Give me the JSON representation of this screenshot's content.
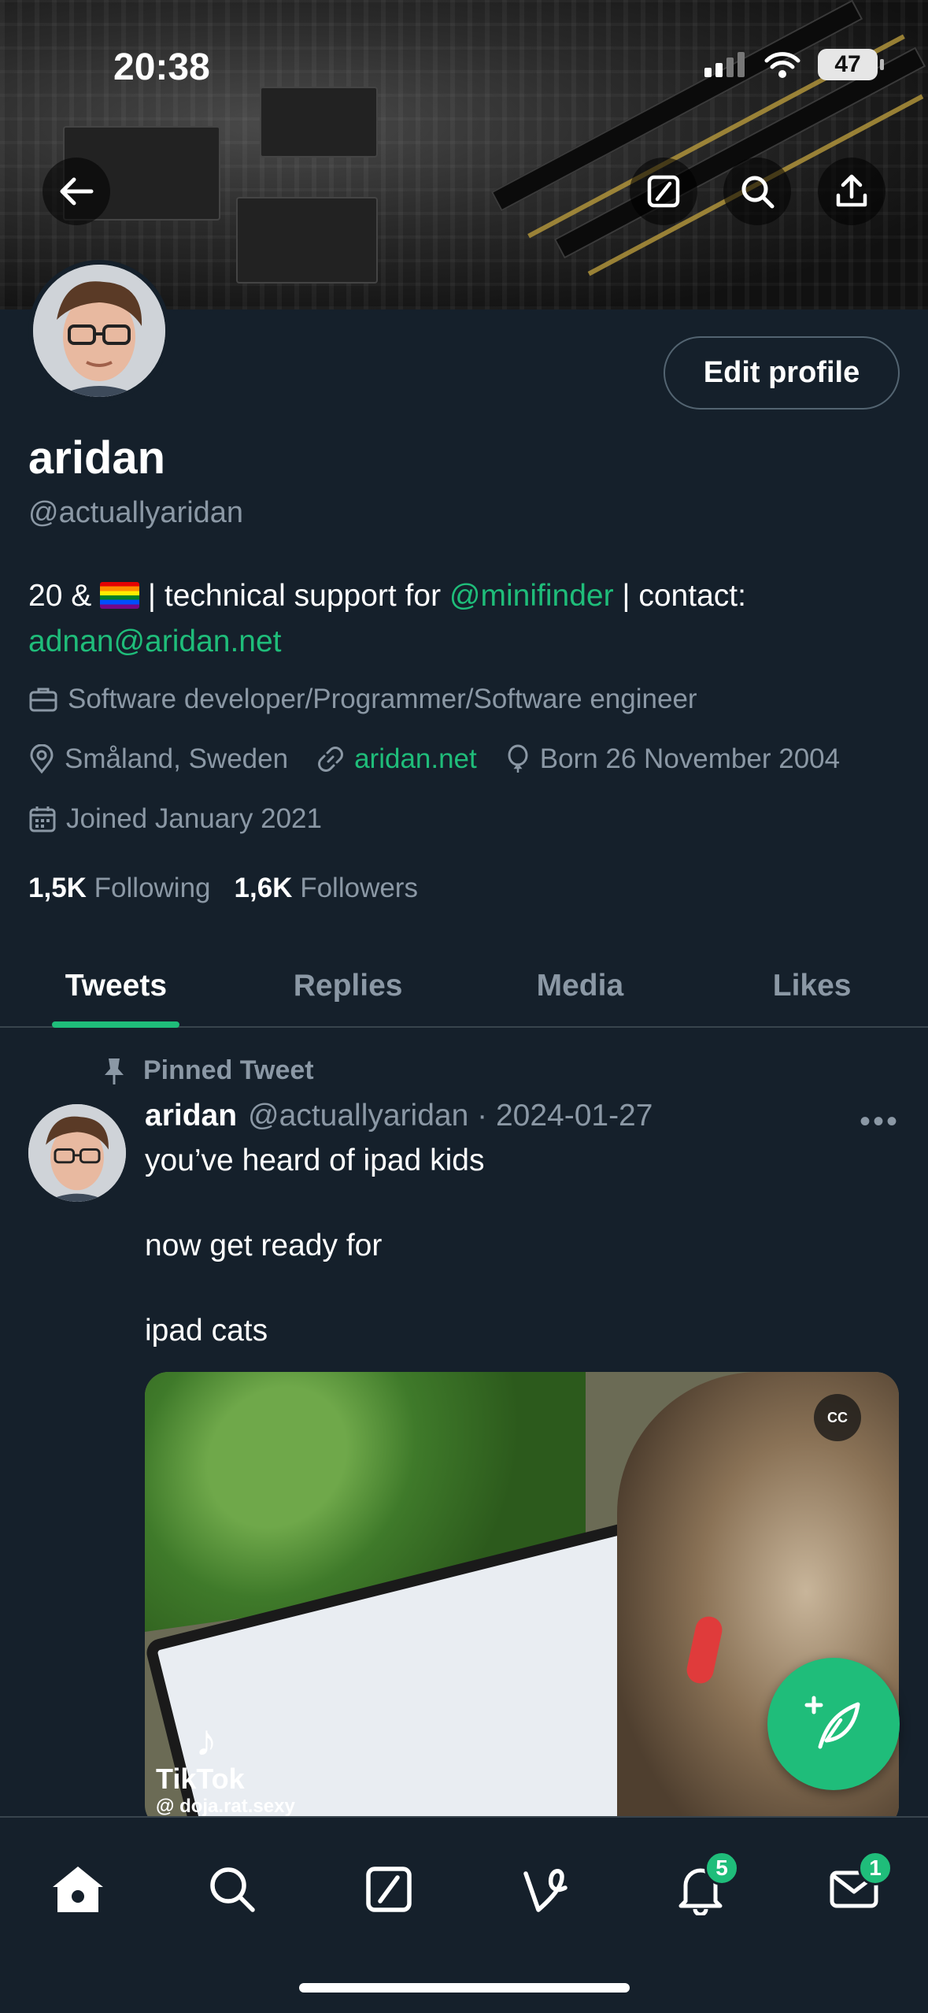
{
  "status_bar": {
    "time": "20:38",
    "battery": "47"
  },
  "profile": {
    "edit_button": "Edit profile",
    "display_name": "aridan",
    "handle": "@actuallyaridan",
    "bio": {
      "prefix": "20 & ",
      "mid": " | technical support for ",
      "mention": "@minifinder",
      "suffix": " | contact:",
      "email": "adnan@aridan.net"
    },
    "profession": "Software developer/Programmer/Software engineer",
    "location": "Småland, Sweden",
    "website": "aridan.net",
    "birthday": "Born 26 November 2004",
    "joined": "Joined January 2021",
    "following_count": "1,5K",
    "following_label": "Following",
    "followers_count": "1,6K",
    "followers_label": "Followers"
  },
  "tabs": [
    {
      "label": "Tweets"
    },
    {
      "label": "Replies"
    },
    {
      "label": "Media"
    },
    {
      "label": "Likes"
    }
  ],
  "pinned_tweet": {
    "pinned_label": "Pinned Tweet",
    "author_name": "aridan",
    "author_handle_date": "@actuallyaridan · 2024-01-27",
    "more": "•••",
    "lines": [
      "you’ve heard of ipad kids",
      "now get ready for",
      "ipad cats"
    ],
    "media": {
      "cc_label": "CC",
      "tiktok_logo": "♪",
      "tiktok_word": "TikTok",
      "tiktok_user": "@ doja.rat.sexy"
    }
  },
  "bottom_nav": {
    "notifications_badge": "5",
    "messages_badge": "1"
  },
  "colors": {
    "background": "#15202b",
    "accent": "#1fbd7a",
    "secondary_text": "#8b98a5"
  }
}
